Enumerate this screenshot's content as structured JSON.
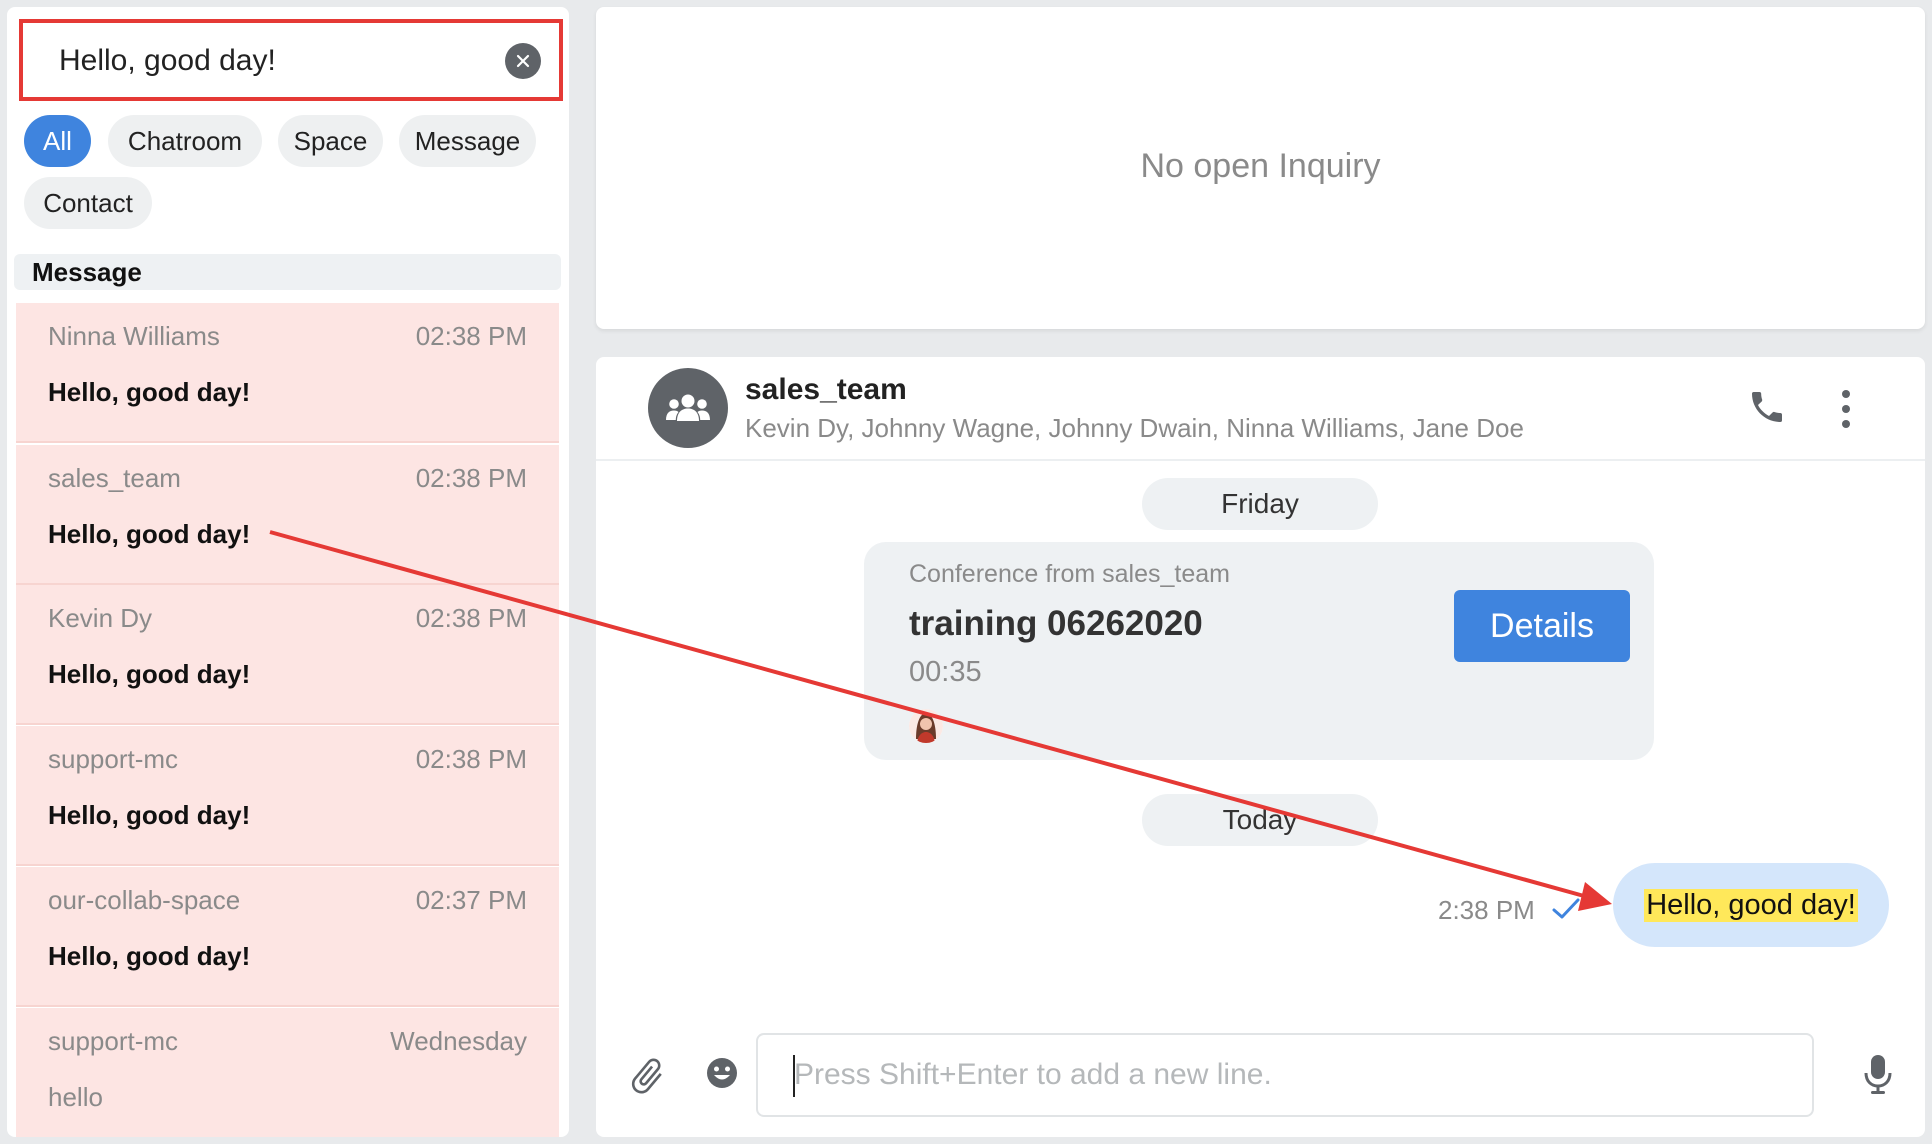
{
  "search": {
    "value": "Hello, good day!",
    "clear_icon": "close-icon"
  },
  "filters": [
    {
      "label": "All",
      "active": true
    },
    {
      "label": "Chatroom",
      "active": false
    },
    {
      "label": "Space",
      "active": false
    },
    {
      "label": "Message",
      "active": false
    },
    {
      "label": "Contact",
      "active": false
    }
  ],
  "results_section": {
    "title": "Message",
    "items": [
      {
        "name": "Ninna Williams",
        "time": "02:38 PM",
        "message": "Hello, good day!"
      },
      {
        "name": "sales_team",
        "time": "02:38 PM",
        "message": "Hello, good day!"
      },
      {
        "name": "Kevin Dy",
        "time": "02:38 PM",
        "message": "Hello, good day!"
      },
      {
        "name": "support-mc",
        "time": "02:38 PM",
        "message": "Hello, good day!"
      },
      {
        "name": "our-collab-space",
        "time": "02:37 PM",
        "message": "Hello, good day!"
      },
      {
        "name": "support-mc",
        "time": "Wednesday",
        "message": "hello"
      }
    ]
  },
  "inquiry": {
    "empty_text": "No open Inquiry"
  },
  "chat": {
    "title": "sales_team",
    "members": "Kevin Dy, Johnny Wagne, Johnny Dwain, Ninna Williams, Jane Doe",
    "avatar_icon": "group-icon",
    "call_icon": "phone-icon",
    "menu_icon": "more-vertical-icon",
    "day_friday": "Friday",
    "conference": {
      "from": "Conference from sales_team",
      "title": "training 06262020",
      "duration": "00:35",
      "details_label": "Details"
    },
    "day_today": "Today",
    "message": {
      "time": "2:38 PM",
      "text": "Hello, good day!",
      "status_icon": "check-icon"
    },
    "composer": {
      "placeholder": "Press Shift+Enter to add a new line.",
      "attach_icon": "paperclip-icon",
      "emoji_icon": "emoji-icon",
      "mic_icon": "microphone-icon"
    }
  },
  "colors": {
    "accent": "#3f84de",
    "highlight_row": "#fde5e3",
    "annotation_red": "#e53935",
    "bubble": "#d4e6fb",
    "text_highlight": "#ffe85a"
  }
}
